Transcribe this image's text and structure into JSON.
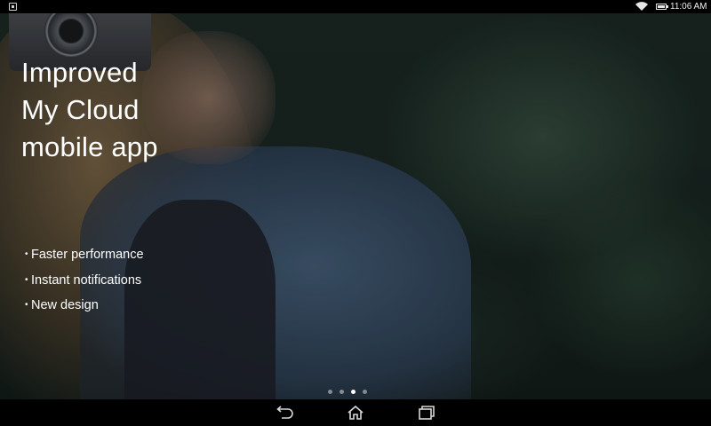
{
  "status_bar": {
    "time": "11:06 AM",
    "icons": [
      "screenshot-notification-icon",
      "wifi-icon",
      "battery-icon"
    ]
  },
  "hero": {
    "headline": [
      "Improved",
      "My Cloud",
      "mobile app"
    ],
    "features": [
      "Faster performance",
      "Instant notifications",
      "New design"
    ],
    "bullet": "•",
    "pager": {
      "pages": 4,
      "active_index": 2
    }
  },
  "nav_bar": {
    "buttons": [
      "back-icon",
      "home-icon",
      "recent-apps-icon"
    ]
  },
  "colors": {
    "text": "#ffffff",
    "background": "#17231f",
    "bars": "#000000"
  }
}
